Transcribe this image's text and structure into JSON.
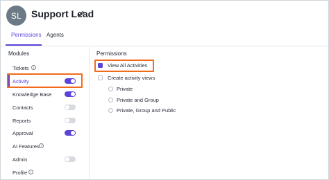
{
  "header": {
    "avatar_initials": "SL",
    "role_name": "Support Lead",
    "edit_icon": "pencil-icon"
  },
  "tabs": [
    {
      "label": "Permissions",
      "active": true
    },
    {
      "label": "Agents",
      "active": false
    }
  ],
  "modules": {
    "heading": "Modules",
    "items": [
      {
        "label": "Tickets",
        "info": true,
        "toggle": null
      },
      {
        "label": "Activity",
        "info": false,
        "toggle": "on",
        "selected": true
      },
      {
        "label": "Knowledge Base",
        "info": false,
        "toggle": "on"
      },
      {
        "label": "Contacts",
        "info": false,
        "toggle": "off"
      },
      {
        "label": "Reports",
        "info": false,
        "toggle": "off"
      },
      {
        "label": "Approval",
        "info": false,
        "toggle": "on"
      },
      {
        "label": "AI Features",
        "info": true,
        "toggle": null
      },
      {
        "label": "Admin",
        "info": false,
        "toggle": "off"
      },
      {
        "label": "Profile",
        "info": true,
        "toggle": null
      }
    ]
  },
  "permissions": {
    "heading": "Permissions",
    "view_all": {
      "label": "View All Activities",
      "checked": true
    },
    "create_views": {
      "label": "Create activity views",
      "checked": false
    },
    "radio_options": [
      "Private",
      "Private and Group",
      "Private, Group and Public"
    ]
  },
  "colors": {
    "accent": "#5b44d9",
    "highlight": "#f26a1b",
    "avatar": "#6b7a86"
  }
}
